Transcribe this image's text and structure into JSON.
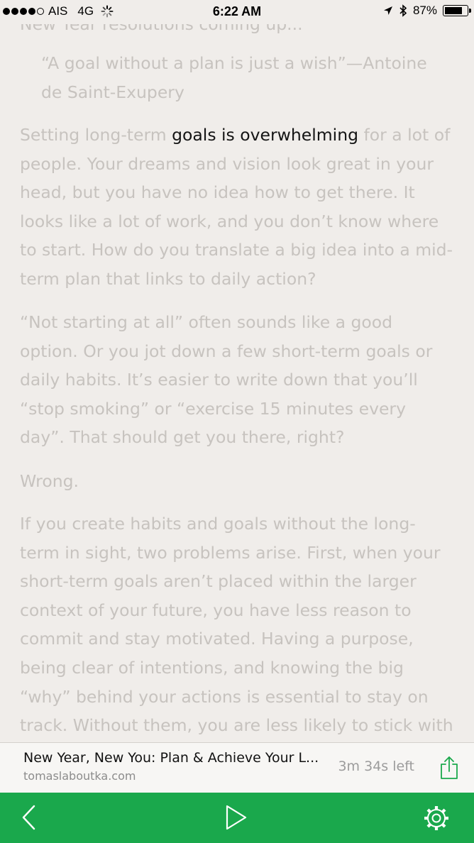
{
  "status_bar": {
    "carrier": "AIS",
    "network": "4G",
    "time": "6:22 AM",
    "battery": "87%",
    "battery_level": 0.87
  },
  "article": {
    "cutoff_line": "New Year resolutions coming up...",
    "quote": "“A goal without a plan is just a wish”—Antoine de Saint-Exupery",
    "p1_before": "Setting long-term ",
    "p1_highlight": "goals is overwhelming",
    "p1_after": " for a lot of people. Your dreams and vision look great in your head, but you have no idea how to get there. It looks like a lot of work, and you don’t know where to start. How do you translate a big idea into a mid-term plan that links to daily action?",
    "p2": "“Not starting at all” often sounds like a good option. Or you jot down a few short-term goals or daily habits. It’s easier to write down that you’ll “stop smoking” or “exercise 15 minutes every day”. That should get you there, right?",
    "p3": "Wrong.",
    "p4": "If you create habits and goals without the long-term in sight, two problems arise. First, when your short-term goals aren’t placed within the larger context of your future, you have less reason to commit and stay motivated. Having a purpose, being clear of intentions, and knowing the big “why” behind your actions is essential to stay on track. Without them, you are less likely to stick with new habits and nail"
  },
  "info_bar": {
    "title": "New Year, New You: Plan & Achieve Your L...",
    "source": "tomaslaboutka.com",
    "time_left": "3m 34s left"
  },
  "toolbar": {
    "back_icon": "chevron-left-icon",
    "play_icon": "play-icon",
    "settings_icon": "gear-icon"
  },
  "colors": {
    "background": "#f0edea",
    "faded_text": "#c7c3bf",
    "highlight_text": "#141414",
    "toolbar": "#1aa84c",
    "accent": "#1aa84c"
  }
}
